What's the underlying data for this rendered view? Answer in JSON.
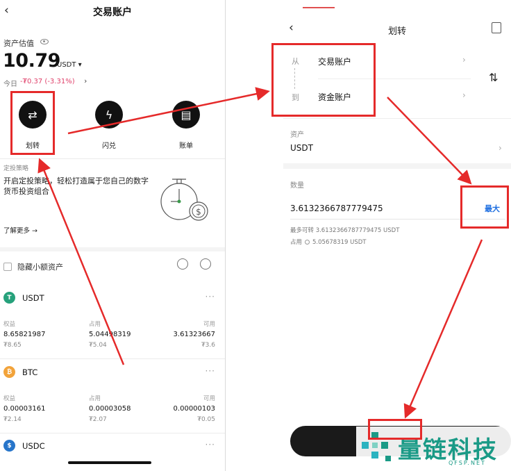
{
  "left": {
    "header": {
      "back_icon": "chevron-left-icon",
      "title": "交易账户"
    },
    "estimate": {
      "label": "资产估值",
      "value": "10.79",
      "unit": "USDT ▾",
      "today_label": "今日",
      "today_change": "-₮0.37 (-3.31%)",
      "today_arrow": "›"
    },
    "actions": [
      {
        "label": "划转",
        "icon": "transfer-icon",
        "glyph": "⇄"
      },
      {
        "label": "闪兑",
        "icon": "flash-exchange-icon",
        "glyph": "ϟ"
      },
      {
        "label": "账单",
        "icon": "bill-icon",
        "glyph": "▤"
      }
    ],
    "strategy": {
      "label": "定投策略",
      "text": "开启定投策略，轻松打造属于您自己的数字货币投资组合",
      "learn_more": "了解更多 →"
    },
    "hide_small": {
      "label": "隐藏小额资产"
    },
    "assets": [
      {
        "symbol": "USDT",
        "coin_letter": "T",
        "color": "#26a17b",
        "equity_label": "权益",
        "equity": "8.65821987",
        "equity_fiat": "₮8.65",
        "occupied_label": "占用",
        "occupied": "5.04498319",
        "occupied_fiat": "₮5.04",
        "available_label": "可用",
        "available": "3.61323667",
        "available_fiat": "₮3.6"
      },
      {
        "symbol": "BTC",
        "coin_letter": "₿",
        "color": "#f2a33a",
        "equity_label": "权益",
        "equity": "0.00003161",
        "equity_fiat": "₮2.14",
        "occupied_label": "占用",
        "occupied": "0.00003058",
        "occupied_fiat": "₮2.07",
        "available_label": "可用",
        "available": "0.00000103",
        "available_fiat": "₮0.05"
      },
      {
        "symbol": "USDC",
        "coin_letter": "$",
        "color": "#2775ca"
      }
    ],
    "more_glyph": "···"
  },
  "right": {
    "header": {
      "back_icon": "chevron-left-icon",
      "title": "划转",
      "history_icon": "transfer-history-icon"
    },
    "from_label": "从",
    "from_account": "交易账户",
    "to_label": "到",
    "to_account": "资金账户",
    "swap_glyph": "⇅",
    "chevron": "›",
    "asset_label": "资产",
    "asset_value": "USDT",
    "quantity_label": "数量",
    "quantity_value": "3.6132366787779475",
    "max_button": "最大",
    "max_transferable": "最多可转  3.6132366787779475 USDT",
    "occupied_label": "占用",
    "occupied_value": "5.05678319 USDT"
  },
  "watermark": {
    "text": "量链科技",
    "sub": "QFSP.NET"
  },
  "colors": {
    "accent_red": "#e52a2a",
    "link_blue": "#1f6fe0",
    "negative": "#e0406a",
    "watermark": "#1a9a86"
  }
}
